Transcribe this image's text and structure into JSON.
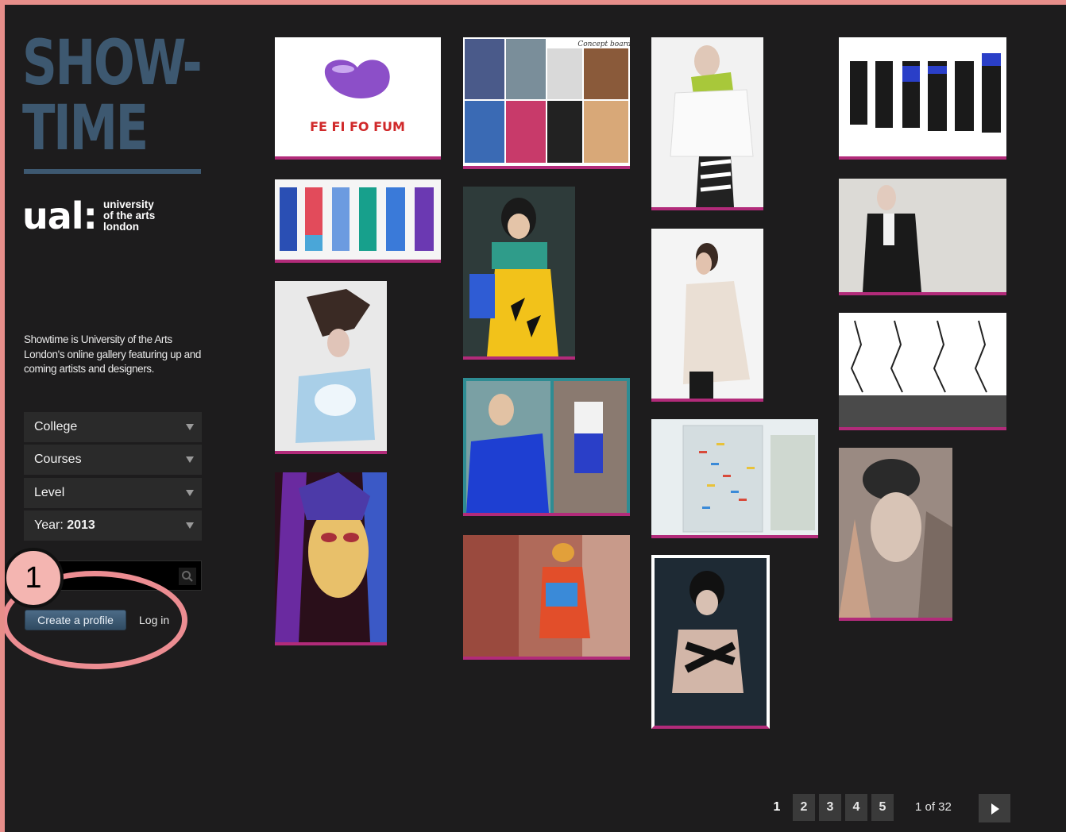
{
  "brand": {
    "logo_line1": "SHOW-",
    "logo_line2": "TIME",
    "ual_mark": "ual:",
    "ual_line1": "university",
    "ual_line2": "of the arts",
    "ual_line3": "london"
  },
  "intro_text": "Showtime is University of the Arts London's online gallery featuring up and coming artists and designers.",
  "filters": {
    "college": "College",
    "courses": "Courses",
    "level": "Level",
    "year_label": "Year:",
    "year_value": "2013"
  },
  "search": {
    "value": "",
    "placeholder": ""
  },
  "account": {
    "create_profile": "Create a profile",
    "login": "Log in"
  },
  "annotation": {
    "number": "1"
  },
  "gallery": {
    "tile1_logo_text": "FE FI FO FUM",
    "tile2_caption": "Concept board"
  },
  "pagination": {
    "pages": [
      "1",
      "2",
      "3",
      "4",
      "5"
    ],
    "current": "1",
    "count_text": "1 of 32"
  },
  "colors": {
    "background": "#1d1c1d",
    "logo_blue": "#3d5870",
    "tile_underline": "#b22b7a",
    "annotation_pink": "#ec8d92"
  }
}
